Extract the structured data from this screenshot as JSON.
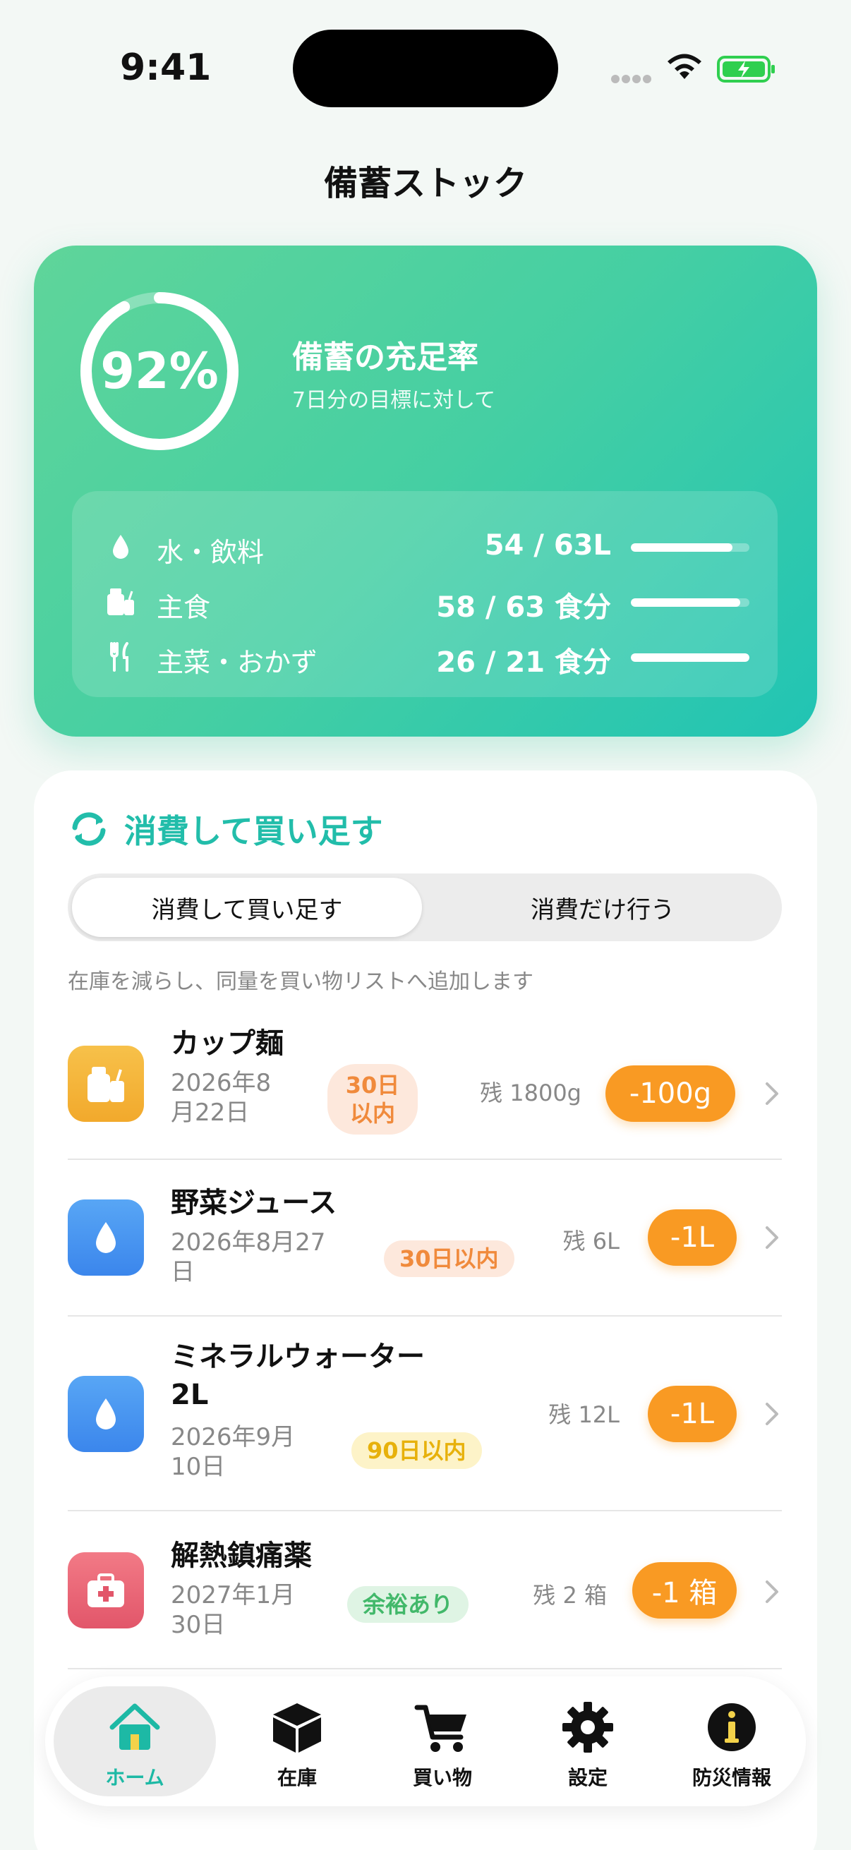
{
  "status": {
    "time": "9:41"
  },
  "header": {
    "title": "備蓄ストック"
  },
  "hero": {
    "percent_label": "92%",
    "percent_value": 0.92,
    "title": "備蓄の充足率",
    "subtitle": "7日分の目標に対して",
    "stats": [
      {
        "icon": "water-drop-icon",
        "label": "水・飲料",
        "value": "54 / 63L",
        "fill": 0.86
      },
      {
        "icon": "food-icon",
        "label": "主食",
        "value": "58 / 63 食分",
        "fill": 0.92
      },
      {
        "icon": "utensils-icon",
        "label": "主菜・おかず",
        "value": "26 / 21 食分",
        "fill": 1.0
      }
    ]
  },
  "consume": {
    "title": "消費して買い足す",
    "segments": [
      "消費して買い足す",
      "消費だけ行う"
    ],
    "hint": "在庫を減らし、同量を買い物リストへ追加します",
    "items": [
      {
        "icon": "food-icon",
        "name": "カップ麺",
        "date": "2026年8月22日",
        "badge": "30日以内",
        "remain": "残 1800g",
        "action": "-100g"
      },
      {
        "icon": "water-drop-icon",
        "name": "野菜ジュース",
        "date": "2026年8月27日",
        "badge": "30日以内",
        "remain": "残 6L",
        "action": "-1L"
      },
      {
        "icon": "water-drop-icon",
        "name": "ミネラルウォーター2L",
        "date": "2026年9月10日",
        "badge": "90日以内",
        "remain": "残 12L",
        "action": "-1L"
      },
      {
        "icon": "first-aid-icon",
        "name": "解熱鎮痛薬",
        "date": "2027年1月30日",
        "badge": "余裕あり",
        "remain": "残 2 箱",
        "action": "-1 箱"
      }
    ]
  },
  "tabs": [
    {
      "icon": "home-icon",
      "label": "ホーム"
    },
    {
      "icon": "box-icon",
      "label": "在庫"
    },
    {
      "icon": "cart-icon",
      "label": "買い物"
    },
    {
      "icon": "gear-icon",
      "label": "設定"
    },
    {
      "icon": "info-icon",
      "label": "防災情報"
    }
  ],
  "colors": {
    "accent": "#1db9a5",
    "action": "#f99a23"
  }
}
